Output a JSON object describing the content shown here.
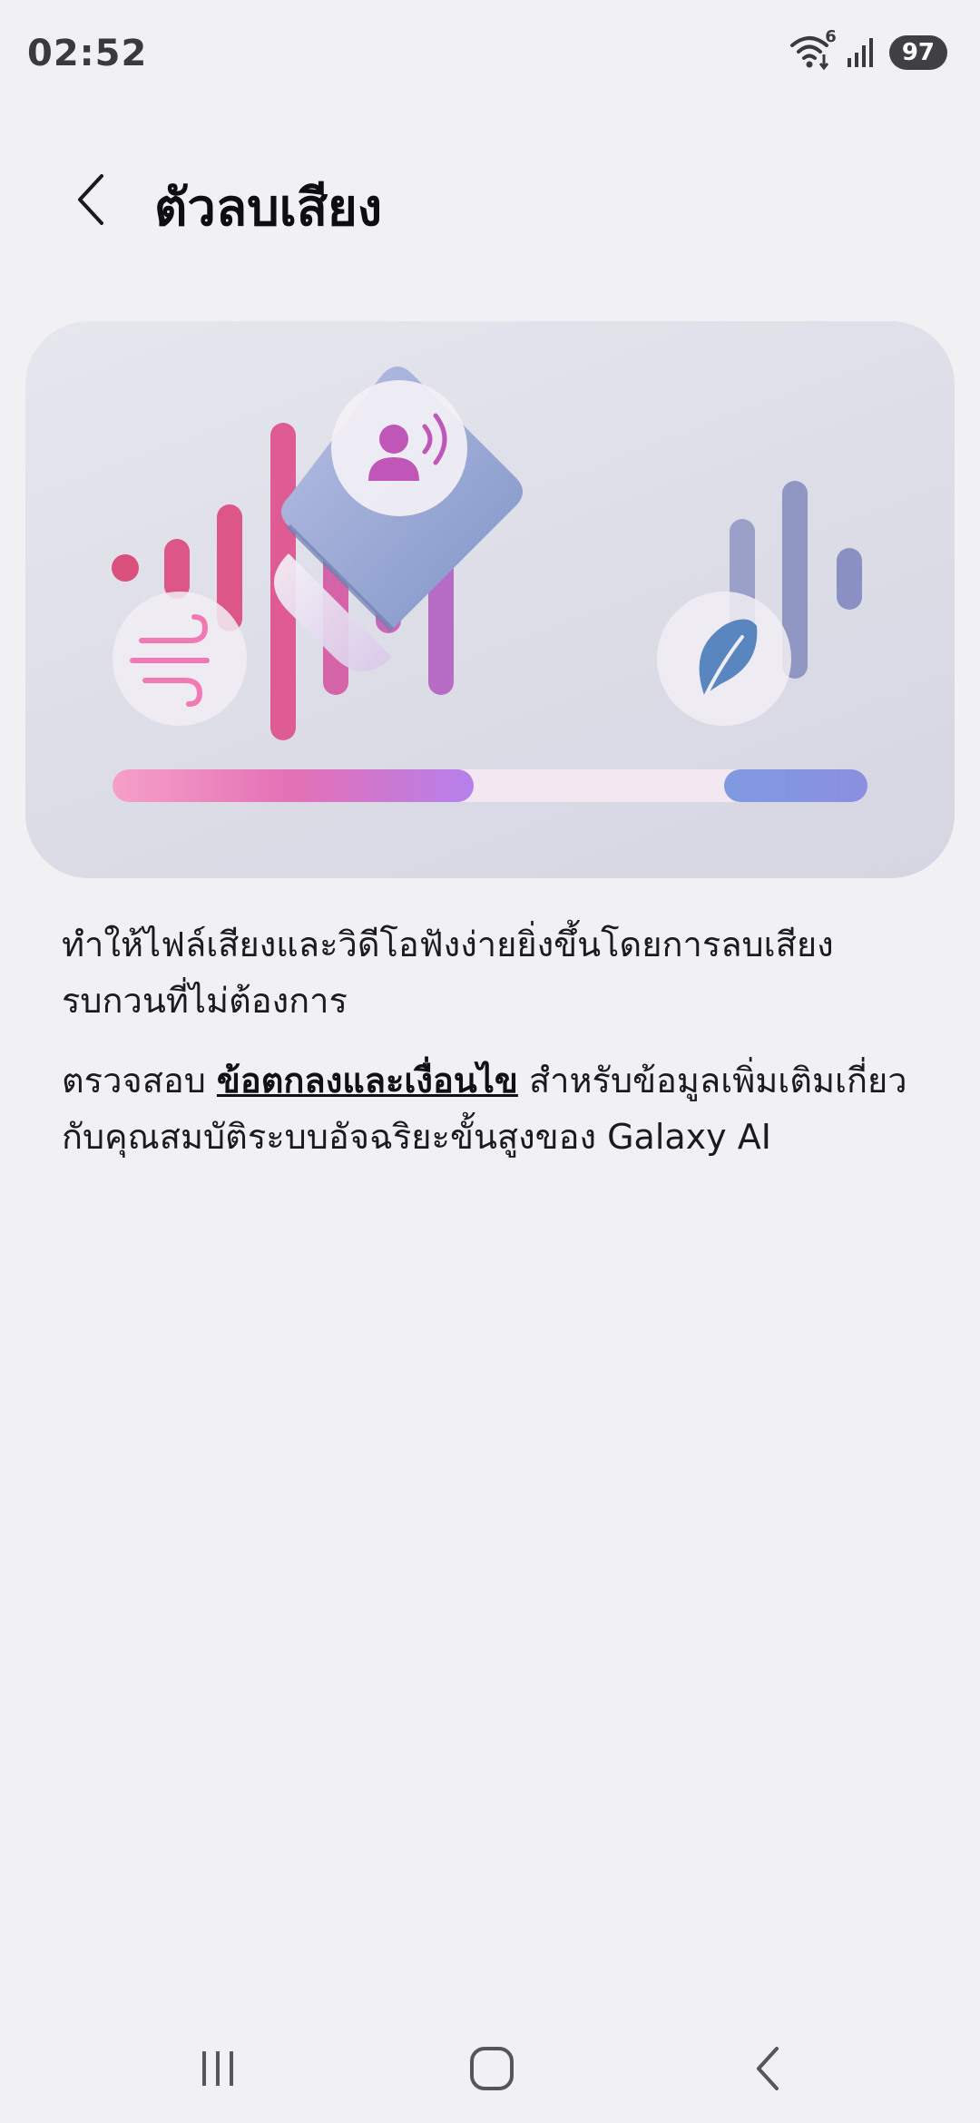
{
  "status_bar": {
    "time": "02:52",
    "battery": "97",
    "wifi_badge": "6",
    "icons": [
      "wifi-icon",
      "signal-icon"
    ]
  },
  "header": {
    "back_icon": "chevron-left-icon",
    "title": "ตัวลบเสียง"
  },
  "illustration": {
    "icons": [
      "wind-icon",
      "speaking-person-icon",
      "eraser-icon",
      "leaf-icon"
    ],
    "colors": {
      "pink": "#e0598f",
      "magenta": "#c35cb8",
      "purple": "#a86ad0",
      "blue_grey": "#9098c6",
      "leaf_blue": "#5a86c0"
    }
  },
  "main": {
    "description": "ทำให้ไฟล์เสียงและวิดีโอฟังง่ายยิ่งขึ้นโดยการลบเสียงรบกวนที่ไม่ต้องการ",
    "terms_prefix": "ตรวจสอบ ",
    "terms_link": "ข้อตกลงและเงื่อนไข",
    "terms_suffix": " สำหรับข้อมูลเพิ่มเติมเกี่ยวกับคุณสมบัติระบบอัจฉริยะขั้นสูงของ Galaxy AI"
  },
  "nav_bar": {
    "icons": [
      "recents-icon",
      "home-icon",
      "back-icon"
    ]
  }
}
